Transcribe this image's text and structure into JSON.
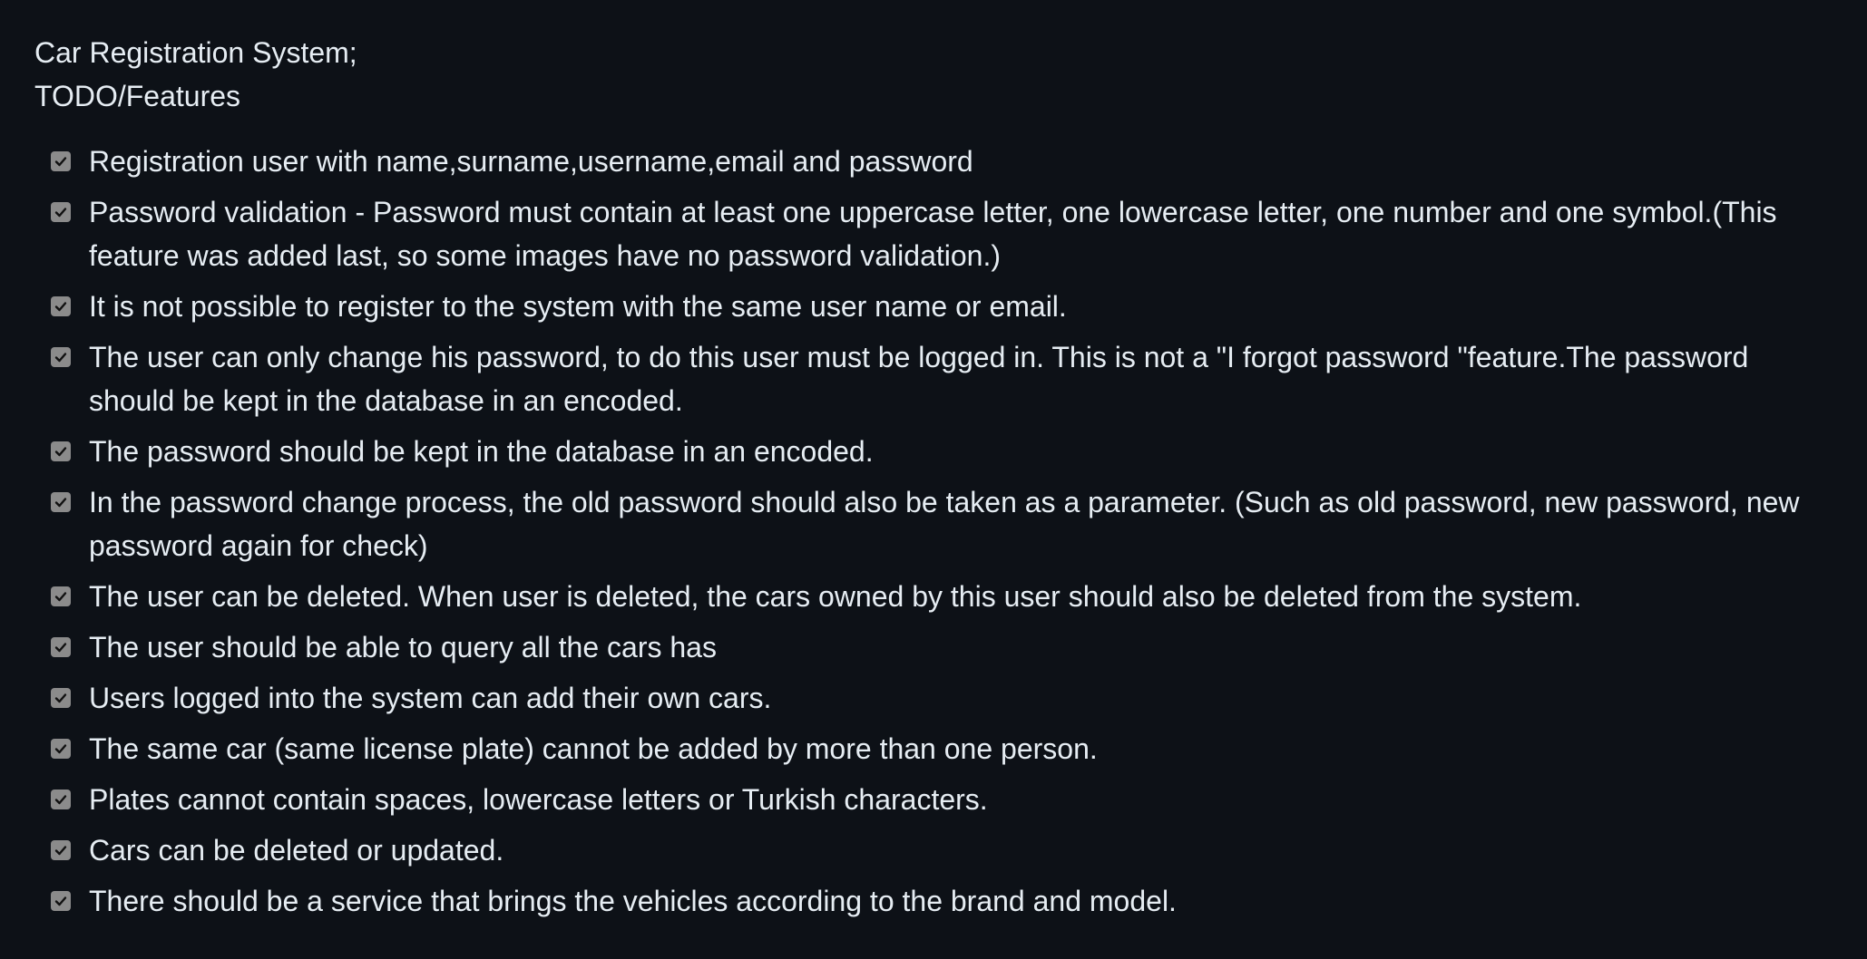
{
  "readme": {
    "title_line1": "Car Registration System;",
    "title_line2": "TODO/Features",
    "tasks": [
      {
        "checked": true,
        "text": "Registration user with name,surname,username,email and password"
      },
      {
        "checked": true,
        "text": "Password validation - Password must contain at least one uppercase letter, one lowercase letter, one number and one symbol.(This feature was added last, so some images have no password validation.)"
      },
      {
        "checked": true,
        "text": "It is not possible to register to the system with the same user name or email."
      },
      {
        "checked": true,
        "text": "The user can only change his password, to do this user must be logged in. This is not a \"I forgot password \"feature.The password should be kept in the database in an encoded."
      },
      {
        "checked": true,
        "text": "The password should be kept in the database in an encoded."
      },
      {
        "checked": true,
        "text": "In the password change process, the old password should also be taken as a parameter. (Such as old password, new password, new password again for check)"
      },
      {
        "checked": true,
        "text": "The user can be deleted. When user is deleted, the cars owned by this user should also be deleted from the system."
      },
      {
        "checked": true,
        "text": "The user should be able to query all the cars has"
      },
      {
        "checked": true,
        "text": "Users logged into the system can add their own cars."
      },
      {
        "checked": true,
        "text": "The same car (same license plate) cannot be added by more than one person."
      },
      {
        "checked": true,
        "text": "Plates cannot contain spaces, lowercase letters or Turkish characters."
      },
      {
        "checked": true,
        "text": "Cars can be deleted or updated."
      },
      {
        "checked": true,
        "text": "There should be a service that brings the vehicles according to the brand and model."
      }
    ]
  },
  "colors": {
    "background": "#0d1117",
    "text": "#e6edf3",
    "checkbox": "#8b8b8b"
  }
}
